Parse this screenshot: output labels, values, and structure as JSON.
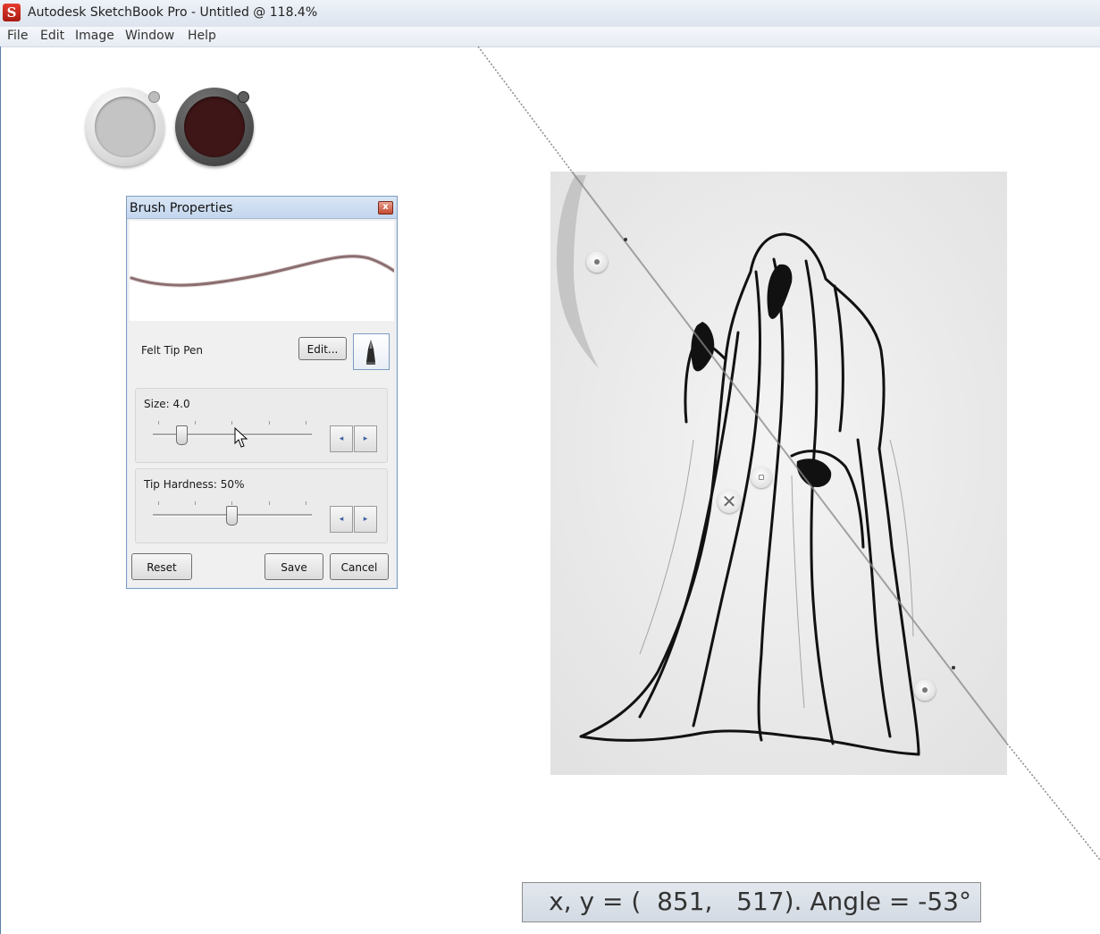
{
  "window": {
    "title": "Autodesk SketchBook Pro - Untitled @ 118.4%",
    "icon": "sketchbook-app-icon",
    "icon_glyph": "S"
  },
  "menu": {
    "items": [
      "File",
      "Edit",
      "Image",
      "Window",
      "Help"
    ]
  },
  "colors": {
    "foreground": "#c4c4c4",
    "background": "#3f1617",
    "accent": "#7d9cc0"
  },
  "brush_panel": {
    "title": "Brush Properties",
    "close_glyph": "x",
    "brush_name": "Felt Tip Pen",
    "edit_label": "Edit...",
    "size_label": "Size: 4.0",
    "size_value": 4.0,
    "hardness_label": "Tip Hardness: 50%",
    "hardness_value": 50,
    "stepper_left": "◂",
    "stepper_right": "▸",
    "reset_label": "Reset",
    "save_label": "Save",
    "cancel_label": "Cancel"
  },
  "ruler": {
    "close_glyph": "✕"
  },
  "status": {
    "readout": "x, y = (  851,   517). Angle = -53°"
  }
}
